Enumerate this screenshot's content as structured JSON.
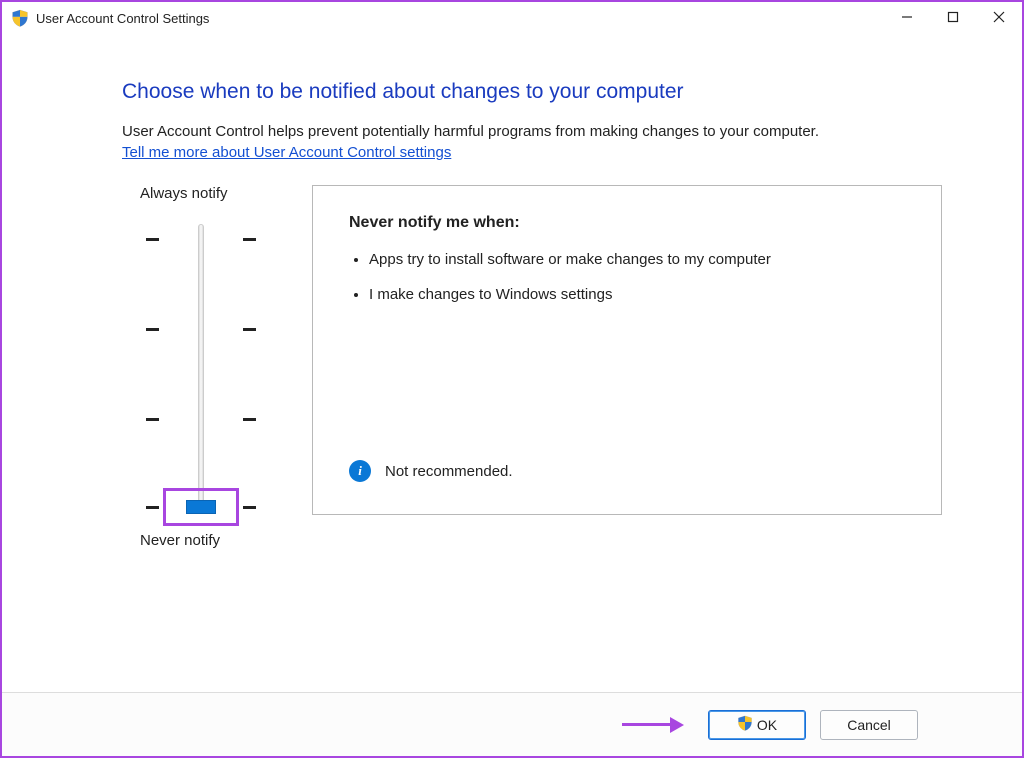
{
  "window_title": "User Account Control Settings",
  "heading": "Choose when to be notified about changes to your computer",
  "intro_text": "User Account Control helps prevent potentially harmful programs from making changes to your computer.",
  "link_text": "Tell me more about User Account Control settings",
  "slider": {
    "top_label": "Always notify",
    "bottom_label": "Never notify",
    "levels": 4,
    "current_level": 0
  },
  "detail": {
    "title": "Never notify me when:",
    "bullets": [
      "Apps try to install software or make changes to my computer",
      "I make changes to Windows settings"
    ],
    "status_icon": "info",
    "status_text": "Not recommended."
  },
  "buttons": {
    "ok_label": "OK",
    "cancel_label": "Cancel"
  },
  "colors": {
    "highlight": "#a846e0",
    "accent_blue": "#0a78d6",
    "heading_blue": "#1a3bbf",
    "link_blue": "#1450d2"
  }
}
